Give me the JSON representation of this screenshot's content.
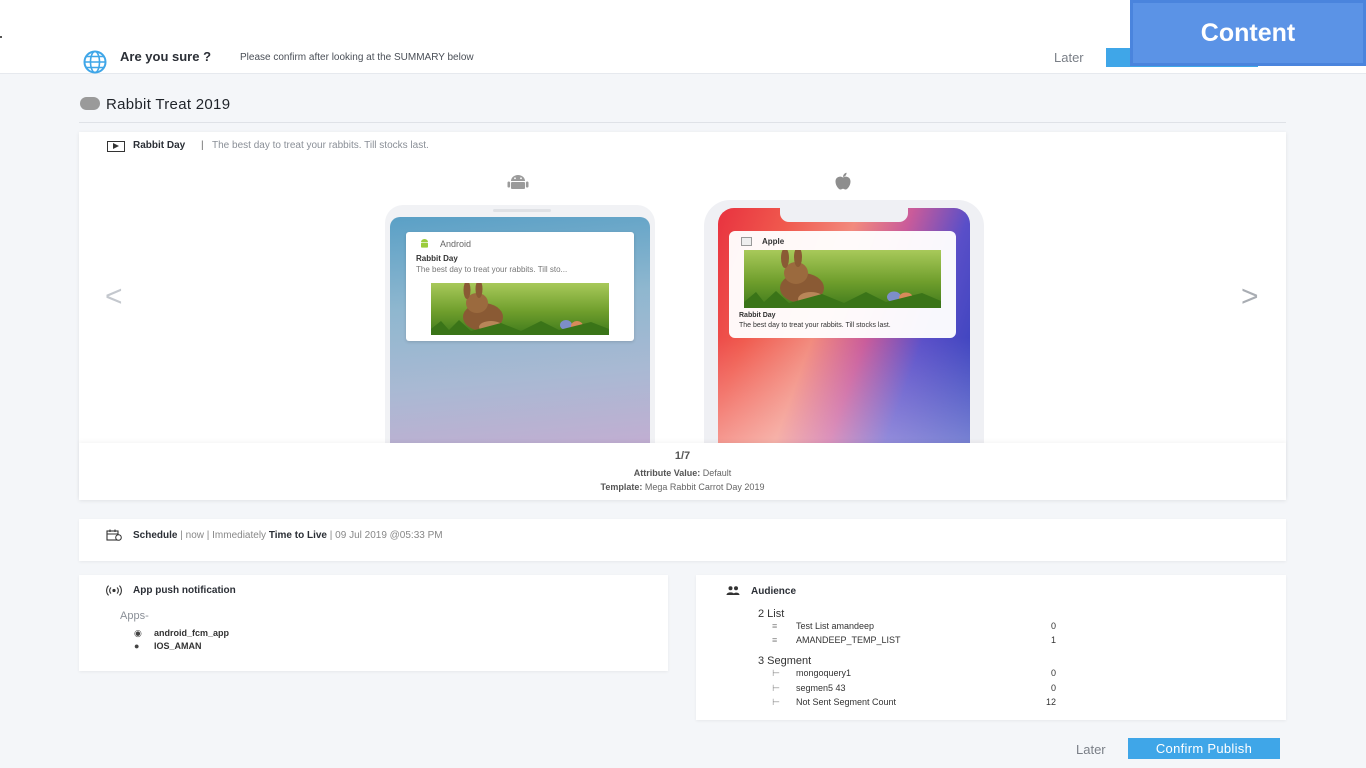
{
  "header": {
    "confirm_title": "Are you sure ?",
    "confirm_subtitle": "Please confirm after looking at the SUMMARY below",
    "later_label": "Later",
    "confirm_button_label": "Confirm Publish",
    "content_tag": "Content"
  },
  "campaign": {
    "title": "Rabbit Treat 2019"
  },
  "preview": {
    "message_title": "Rabbit Day",
    "separator": "|",
    "message_body": "The best day to treat your rabbits. Till stocks last.",
    "prev_label": "<",
    "next_label": ">",
    "android": {
      "app_name": "Android",
      "notif_title": "Rabbit Day",
      "notif_body": "The best day to treat your rabbits. Till sto..."
    },
    "ios": {
      "app_name": "Apple",
      "notif_title": "Rabbit Day",
      "notif_body": "The best day to treat your rabbits. Till stocks last."
    },
    "page_count": "1/7",
    "attribute_label": "Attribute Value:",
    "attribute_value": "Default",
    "template_label": "Template:",
    "template_value": "Mega Rabbit Carrot Day 2019"
  },
  "schedule": {
    "label": "Schedule",
    "sep1": "|",
    "when": "now | Immediately",
    "ttl_label": "Time to Live",
    "sep2": "|",
    "ttl_value": "09 Jul 2019 @05:33 PM"
  },
  "app_push": {
    "title": "App push notification",
    "apps_label": "Apps-",
    "apps": [
      {
        "name": "android_fcm_app",
        "icon": "android-icon"
      },
      {
        "name": "IOS_AMAN",
        "icon": "apple-icon"
      }
    ]
  },
  "audience": {
    "title": "Audience",
    "list_heading": "2 List",
    "lists": [
      {
        "name": "Test List amandeep",
        "count": "0"
      },
      {
        "name": "AMANDEEP_TEMP_LIST",
        "count": "1"
      }
    ],
    "segment_heading": "3 Segment",
    "segments": [
      {
        "name": "mongoquery1",
        "count": "0"
      },
      {
        "name": "segmen5 43",
        "count": "0"
      },
      {
        "name": "Not Sent Segment Count",
        "count": "12"
      }
    ]
  },
  "footer": {
    "later_label": "Later",
    "confirm_button_label": "Confirm Publish"
  },
  "colors": {
    "primary_button": "#3fa6e8",
    "content_tag": "#5b93e6",
    "status_dot": "#9a9a9a"
  }
}
